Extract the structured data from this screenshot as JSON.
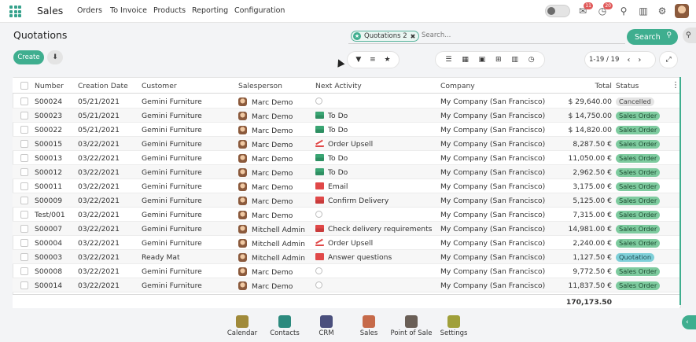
{
  "navbar": {
    "brand": "Sales",
    "menu": [
      "Orders",
      "To Invoice",
      "Products",
      "Reporting",
      "Configuration"
    ],
    "badges": {
      "messages": "11",
      "activities": "20"
    }
  },
  "control_panel": {
    "title": "Quotations",
    "facet": "Quotations 2",
    "search_placeholder": "Search...",
    "search_button": "Search",
    "create_button": "Create",
    "pager": "1-19 / 19"
  },
  "table": {
    "headers": {
      "number": "Number",
      "creation_date": "Creation Date",
      "customer": "Customer",
      "salesperson": "Salesperson",
      "next_activity": "Next Activity",
      "company": "Company",
      "total": "Total",
      "status": "Status"
    },
    "rows": [
      {
        "number": "S00024",
        "date": "05/21/2021",
        "customer": "Gemini Furniture",
        "salesperson": "Marc Demo",
        "activity": "",
        "activity_icon": "clock",
        "company": "My Company (San Francisco)",
        "total": "$ 29,640.00",
        "status": "Cancelled",
        "status_type": "cancel"
      },
      {
        "number": "S00023",
        "date": "05/21/2021",
        "customer": "Gemini Furniture",
        "salesperson": "Marc Demo",
        "activity": "To Do",
        "activity_icon": "todo",
        "company": "My Company (San Francisco)",
        "total": "$ 14,750.00",
        "status": "Sales Order",
        "status_type": "so"
      },
      {
        "number": "S00022",
        "date": "05/21/2021",
        "customer": "Gemini Furniture",
        "salesperson": "Marc Demo",
        "activity": "To Do",
        "activity_icon": "todo",
        "company": "My Company (San Francisco)",
        "total": "$ 14,820.00",
        "status": "Sales Order",
        "status_type": "so"
      },
      {
        "number": "S00015",
        "date": "03/22/2021",
        "customer": "Gemini Furniture",
        "salesperson": "Marc Demo",
        "activity": "Order Upsell",
        "activity_icon": "upsell",
        "company": "My Company (San Francisco)",
        "total": "8,287.50 €",
        "status": "Sales Order",
        "status_type": "so"
      },
      {
        "number": "S00013",
        "date": "03/22/2021",
        "customer": "Gemini Furniture",
        "salesperson": "Marc Demo",
        "activity": "To Do",
        "activity_icon": "todo",
        "company": "My Company (San Francisco)",
        "total": "11,050.00 €",
        "status": "Sales Order",
        "status_type": "so"
      },
      {
        "number": "S00012",
        "date": "03/22/2021",
        "customer": "Gemini Furniture",
        "salesperson": "Marc Demo",
        "activity": "To Do",
        "activity_icon": "todo",
        "company": "My Company (San Francisco)",
        "total": "2,962.50 €",
        "status": "Sales Order",
        "status_type": "so"
      },
      {
        "number": "S00011",
        "date": "03/22/2021",
        "customer": "Gemini Furniture",
        "salesperson": "Marc Demo",
        "activity": "Email",
        "activity_icon": "email",
        "company": "My Company (San Francisco)",
        "total": "3,175.00 €",
        "status": "Sales Order",
        "status_type": "so"
      },
      {
        "number": "S00009",
        "date": "03/22/2021",
        "customer": "Gemini Furniture",
        "salesperson": "Marc Demo",
        "activity": "Confirm Delivery",
        "activity_icon": "phone",
        "company": "My Company (San Francisco)",
        "total": "5,125.00 €",
        "status": "Sales Order",
        "status_type": "so"
      },
      {
        "number": "Test/001",
        "date": "03/22/2021",
        "customer": "Gemini Furniture",
        "salesperson": "Marc Demo",
        "activity": "",
        "activity_icon": "clock",
        "company": "My Company (San Francisco)",
        "total": "7,315.00 €",
        "status": "Sales Order",
        "status_type": "so"
      },
      {
        "number": "S00007",
        "date": "03/22/2021",
        "customer": "Gemini Furniture",
        "salesperson": "Mitchell Admin",
        "activity": "Check delivery requirements",
        "activity_icon": "phone",
        "company": "My Company (San Francisco)",
        "total": "14,981.00 €",
        "status": "Sales Order",
        "status_type": "so"
      },
      {
        "number": "S00004",
        "date": "03/22/2021",
        "customer": "Gemini Furniture",
        "salesperson": "Mitchell Admin",
        "activity": "Order Upsell",
        "activity_icon": "upsell",
        "company": "My Company (San Francisco)",
        "total": "2,240.00 €",
        "status": "Sales Order",
        "status_type": "so"
      },
      {
        "number": "S00003",
        "date": "03/22/2021",
        "customer": "Ready Mat",
        "salesperson": "Mitchell Admin",
        "activity": "Answer questions",
        "activity_icon": "email",
        "company": "My Company (San Francisco)",
        "total": "1,127.50 €",
        "status": "Quotation",
        "status_type": "quote"
      },
      {
        "number": "S00008",
        "date": "03/22/2021",
        "customer": "Gemini Furniture",
        "salesperson": "Marc Demo",
        "activity": "",
        "activity_icon": "clock",
        "company": "My Company (San Francisco)",
        "total": "9,772.50 €",
        "status": "Sales Order",
        "status_type": "so"
      },
      {
        "number": "S00014",
        "date": "03/22/2021",
        "customer": "Gemini Furniture",
        "salesperson": "Marc Demo",
        "activity": "",
        "activity_icon": "clock",
        "company": "My Company (San Francisco)",
        "total": "11,837.50 €",
        "status": "Sales Order",
        "status_type": "so"
      }
    ],
    "grand_total": "170,173.50"
  },
  "dock": [
    {
      "label": "Calendar",
      "icon": "calendar-icon",
      "color": "#a08a3a"
    },
    {
      "label": "Contacts",
      "icon": "contacts-icon",
      "color": "#2c8a7e"
    },
    {
      "label": "CRM",
      "icon": "crm-icon",
      "color": "#4a4f7d"
    },
    {
      "label": "Sales",
      "icon": "sales-icon",
      "color": "#c66a4a"
    },
    {
      "label": "Point of Sale",
      "icon": "pos-icon",
      "color": "#6a5f57"
    },
    {
      "label": "Settings",
      "icon": "settings-icon",
      "color": "#a0a03a"
    }
  ],
  "colors": {
    "accent": "#3fae8f",
    "sales_order": "#7ecb9f",
    "quotation": "#7fd0d9",
    "cancelled": "#e4e4e4"
  }
}
